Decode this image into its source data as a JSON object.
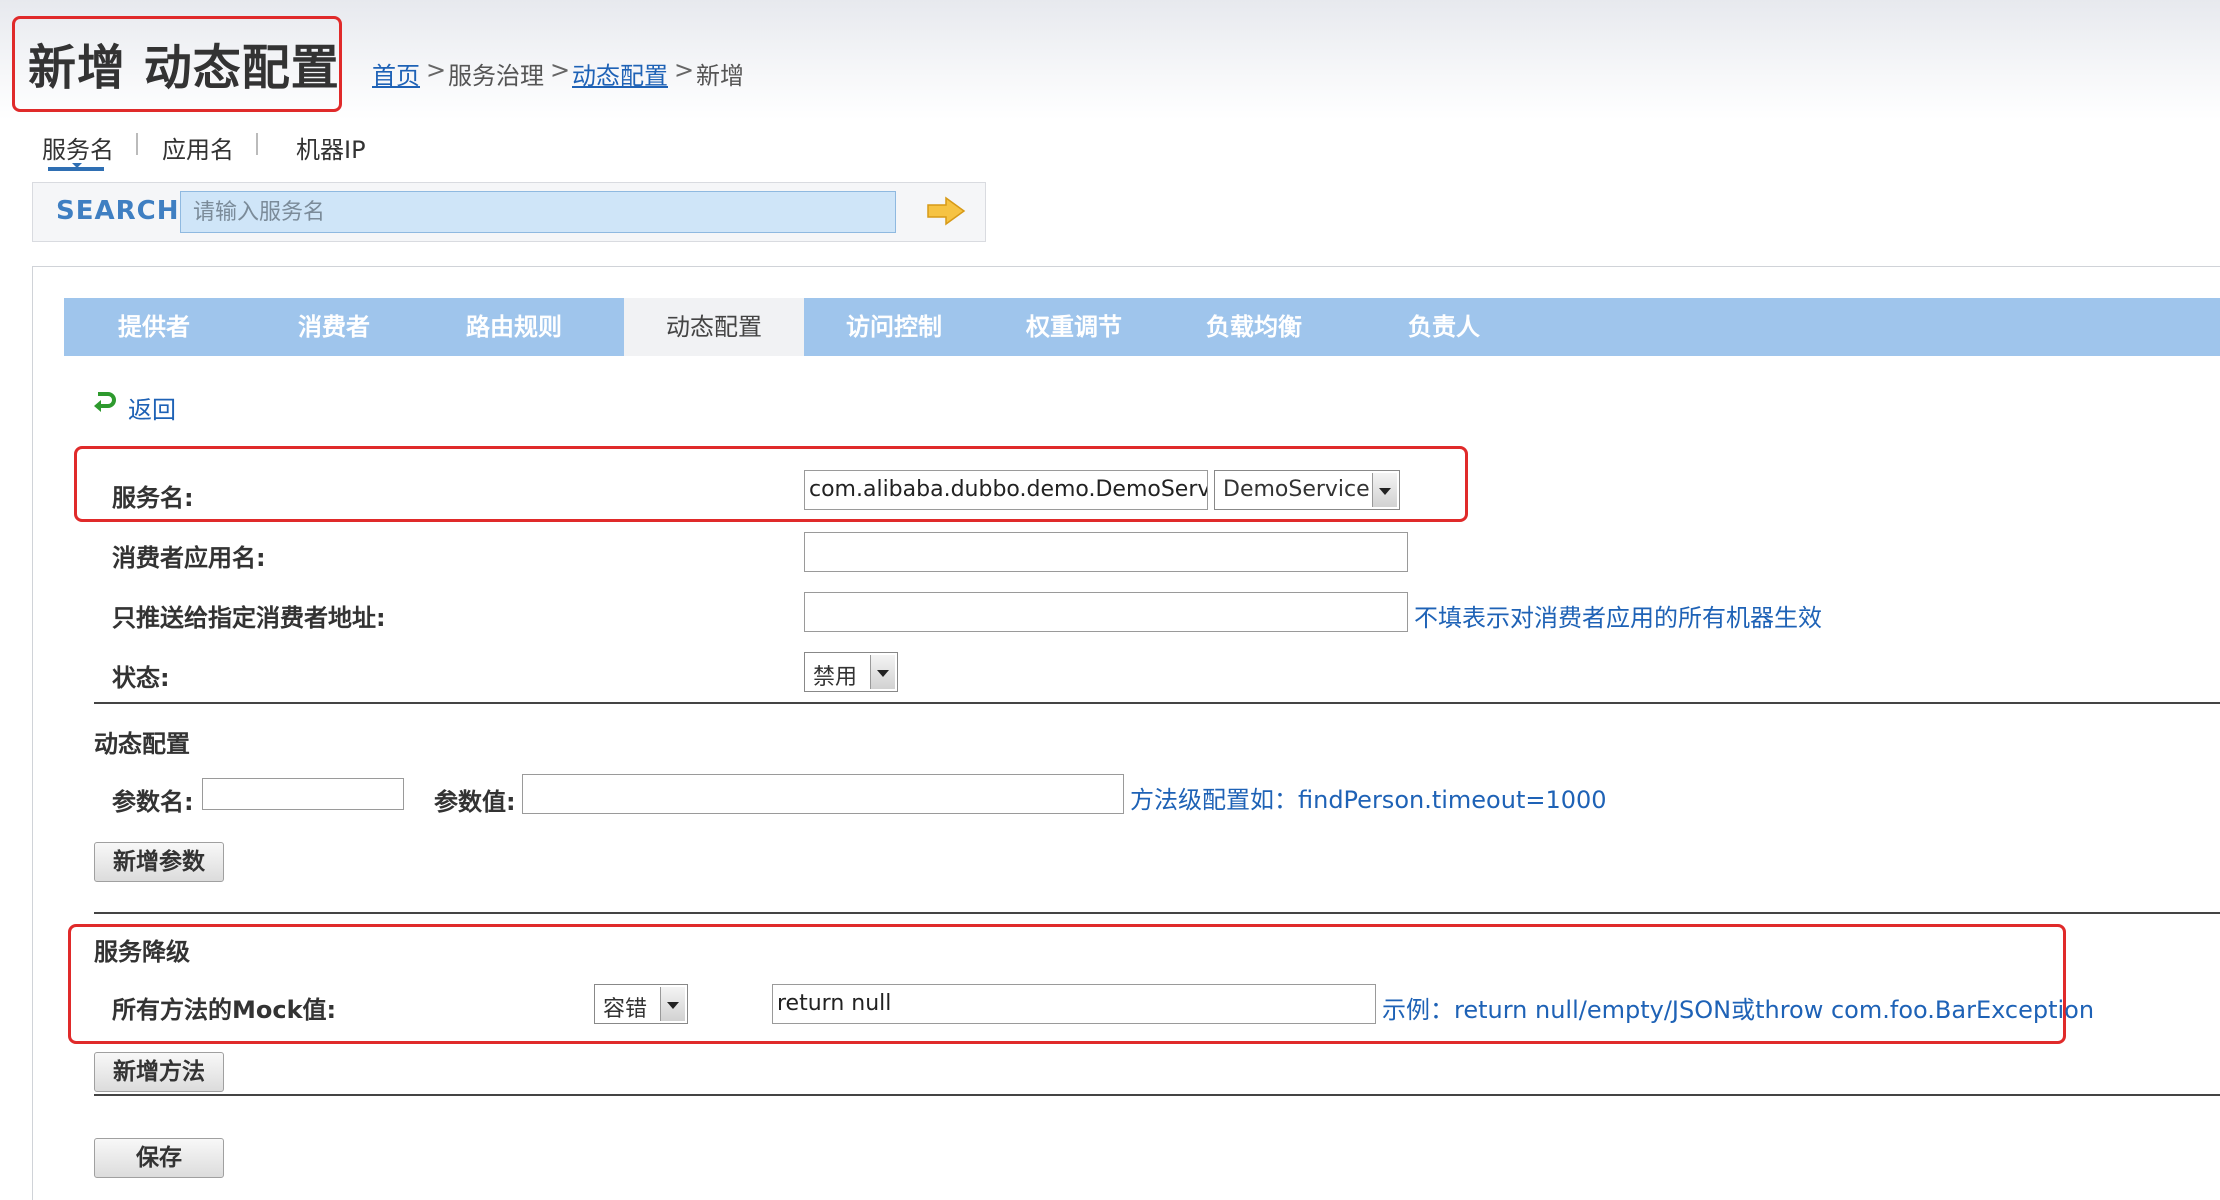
{
  "header": {
    "title": "新增 动态配置",
    "breadcrumb": {
      "home": "首页",
      "sep1": ">",
      "service_gov": "服务治理",
      "sep2": ">",
      "dynamic_config": "动态配置",
      "sep3": ">",
      "current": "新增"
    }
  },
  "search_tabs": [
    "服务名",
    "应用名",
    "机器IP"
  ],
  "search": {
    "label": "SEARCH",
    "placeholder": "请输入服务名"
  },
  "nav_tabs": [
    "提供者",
    "消费者",
    "路由规则",
    "动态配置",
    "访问控制",
    "权重调节",
    "负载均衡",
    "负责人"
  ],
  "active_nav_tab": "动态配置",
  "back_label": "返回",
  "form": {
    "service_label": "服务名:",
    "service_value": "com.alibaba.dubbo.demo.DemoService",
    "service_select": "DemoService",
    "consumer_app_label": "消费者应用名:",
    "consumer_app_value": "",
    "consumer_addr_label": "只推送给指定消费者地址:",
    "consumer_addr_value": "",
    "consumer_addr_hint": "不填表示对消费者应用的所有机器生效",
    "status_label": "状态:",
    "status_value": "禁用"
  },
  "dynamic_section": {
    "title": "动态配置",
    "param_name_label": "参数名:",
    "param_value_label": "参数值:",
    "hint": "方法级配置如：findPerson.timeout=1000",
    "add_param_button": "新增参数"
  },
  "degrade_section": {
    "title": "服务降级",
    "mock_label": "所有方法的Mock值:",
    "mock_type": "容错",
    "mock_value": "return null",
    "hint": "示例：return null/empty/JSON或throw com.foo.BarException",
    "add_method_button": "新增方法"
  },
  "save_button": "保存",
  "colors": {
    "highlight_border": "#e02a2a",
    "nav_bg": "#9fc5ec",
    "link": "#1e62b6",
    "search_input_bg": "#cfe5f8"
  }
}
